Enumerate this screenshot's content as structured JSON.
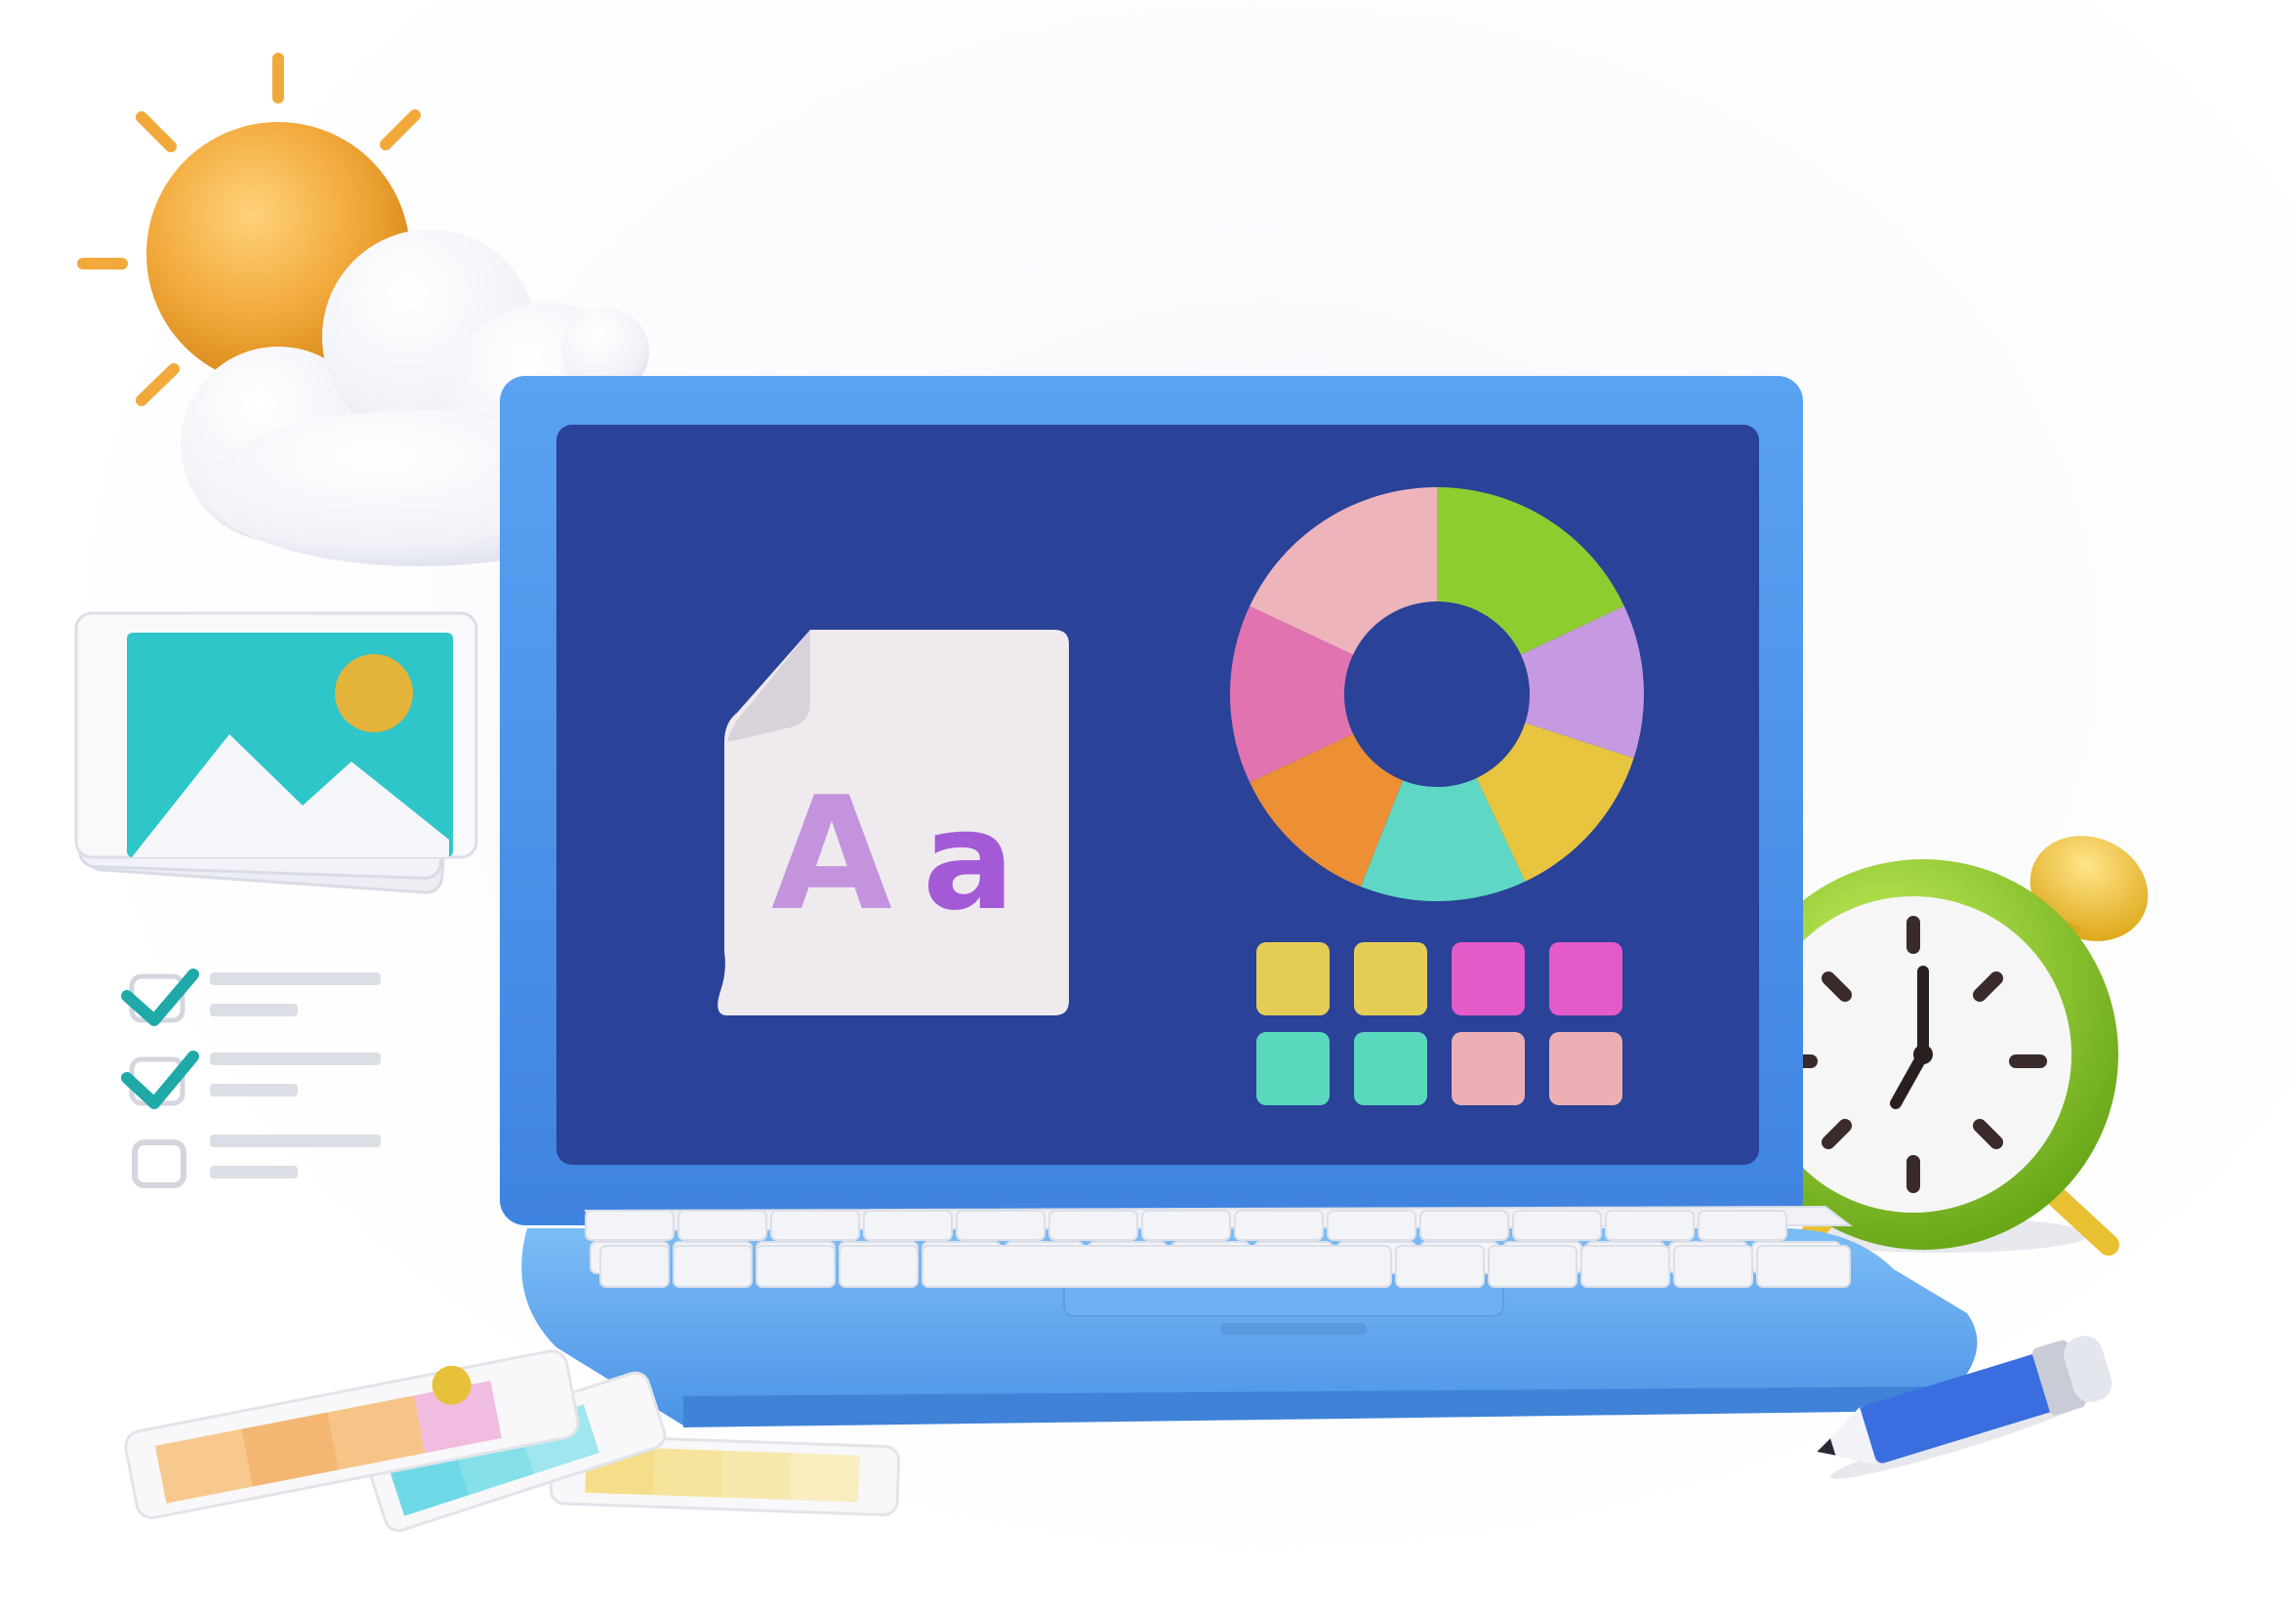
{
  "illustration": {
    "font_sample_text": "Aa",
    "colors": {
      "laptop_body": "#4a8fe8",
      "screen": "#2a4298",
      "sun": "#f2a93b",
      "clock_frame": "#8fd42f",
      "clock_bell": "#f5c842",
      "image_card": "#2ec6c8",
      "pencil": "#3a6ee0",
      "font_letter_a_upper": "#c493de",
      "font_letter_a_lower": "#a45ad6"
    },
    "donut_segments": [
      {
        "name": "green",
        "color": "#8fcc30",
        "share": 0.18
      },
      {
        "name": "lavender",
        "color": "#c69ae0",
        "share": 0.12
      },
      {
        "name": "yellow",
        "color": "#e8c53e",
        "share": 0.13
      },
      {
        "name": "teal",
        "color": "#5ed8c4",
        "share": 0.13
      },
      {
        "name": "orange",
        "color": "#ec8f35",
        "share": 0.12
      },
      {
        "name": "magenta",
        "color": "#e173b0",
        "share": 0.14
      },
      {
        "name": "pink",
        "color": "#eeb4bc",
        "share": 0.18
      }
    ],
    "color_swatches": [
      {
        "name": "yellow",
        "color": "#e4cd55"
      },
      {
        "name": "yellow",
        "color": "#e4cd55"
      },
      {
        "name": "magenta",
        "color": "#e45ac8"
      },
      {
        "name": "magenta",
        "color": "#e45ac8"
      },
      {
        "name": "teal",
        "color": "#5ad8be"
      },
      {
        "name": "teal",
        "color": "#5ad8be"
      },
      {
        "name": "pink",
        "color": "#ecb0b4"
      },
      {
        "name": "pink",
        "color": "#ecb0b4"
      }
    ],
    "checklist": [
      {
        "checked": true
      },
      {
        "checked": true
      },
      {
        "checked": false
      }
    ],
    "clock_time": "7:00"
  }
}
